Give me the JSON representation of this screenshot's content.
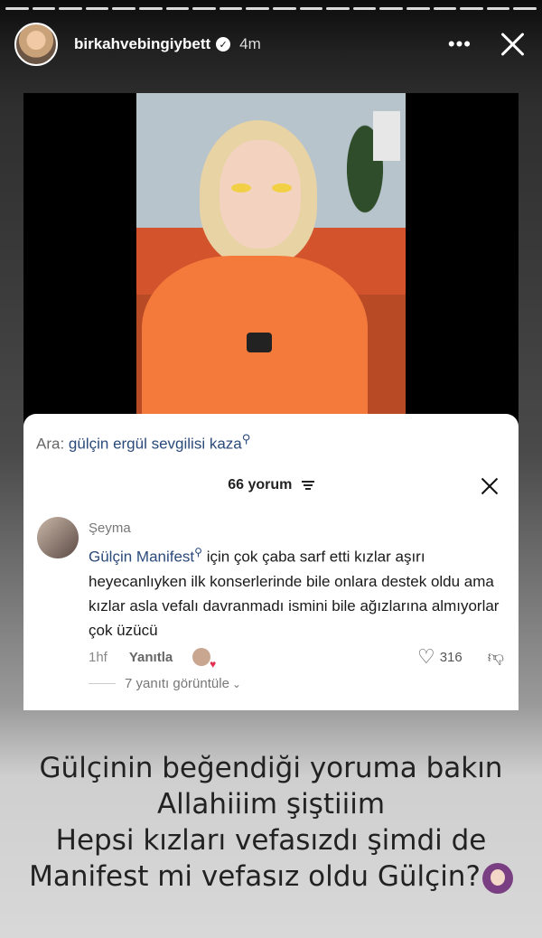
{
  "story": {
    "segments": 20,
    "username": "birkahvebingiybett",
    "verified_icon": "verified-badge-icon",
    "time": "4m",
    "more_icon": "more-dots-icon",
    "close_icon": "close-icon"
  },
  "comments": {
    "search_prefix": "Ara:",
    "search_query": "gülçin ergül sevgilisi kaza",
    "count_label": "66 yorum",
    "comment": {
      "user": "Şeyma",
      "mention": "Gülçin Manifest",
      "text": "için çok çaba sarf etti kızlar aşırı heyecanlıyken ilk konserlerinde bile onlara destek oldu ama kızlar asla vefalı davranmadı ismini bile ağızlarına almıyorlar çok üzücü",
      "age": "1hf",
      "reply_label": "Yanıtla",
      "likes": "316",
      "view_replies": "7 yanıtı görüntüle"
    }
  },
  "caption": {
    "line1": "Gülçinin beğendiği yoruma bakın",
    "line2": "Allahiiim şiştiiim",
    "line3": "Hepsi kızları vefasızdı şimdi de",
    "line4": "Manifest mi vefasız oldu Gülçin?"
  }
}
